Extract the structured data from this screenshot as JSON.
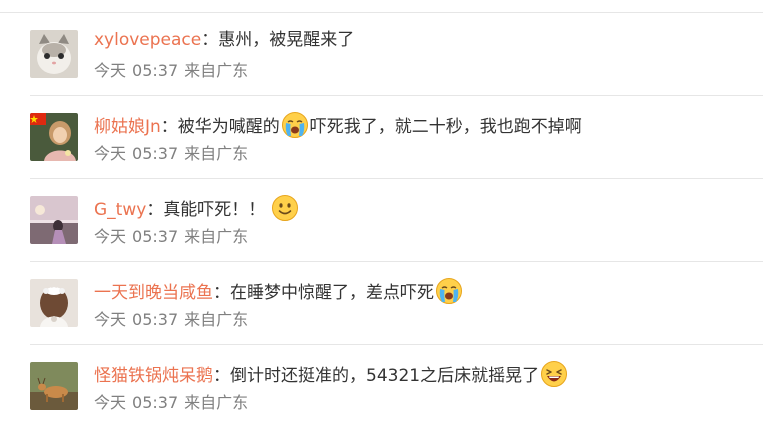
{
  "comments": [
    {
      "username": "xylovepeace",
      "colon": "：",
      "text": "惠州，被晃醒来了",
      "date": "今天",
      "time": "05:37",
      "location": "来自广东",
      "avatar_icon": "cat-photo-avatar"
    },
    {
      "username": "柳姑娘Jn",
      "colon": "：",
      "text_before_emoji": "被华为喊醒的",
      "emoji": "crying-face",
      "text_after_emoji": "吓死我了，就二十秒，我也跑不掉啊",
      "date": "今天",
      "time": "05:37",
      "location": "来自广东",
      "avatar_icon": "woman-with-flag-avatar"
    },
    {
      "username": "G_twy",
      "colon": "：",
      "text": "真能吓死！！",
      "emoji": "smiling-face",
      "date": "今天",
      "time": "05:37",
      "location": "来自广东",
      "avatar_icon": "beach-sunset-avatar"
    },
    {
      "username": "一天到晚当咸鱼",
      "colon": "：",
      "text": "在睡梦中惊醒了，差点吓死",
      "emoji": "crying-face",
      "date": "今天",
      "time": "05:37",
      "location": "来自广东",
      "avatar_icon": "girl-with-bow-avatar"
    },
    {
      "username": "怪猫铁锅炖呆鹅",
      "colon": "：",
      "text": "倒计时还挺准的，54321之后床就摇晃了",
      "emoji": "laughing-face",
      "date": "今天",
      "time": "05:37",
      "location": "来自广东",
      "avatar_icon": "deer-field-avatar"
    }
  ],
  "colors": {
    "username": "#eb7350",
    "body_text": "#333333",
    "meta_text": "#808080",
    "separator": "#e6e6e6"
  }
}
